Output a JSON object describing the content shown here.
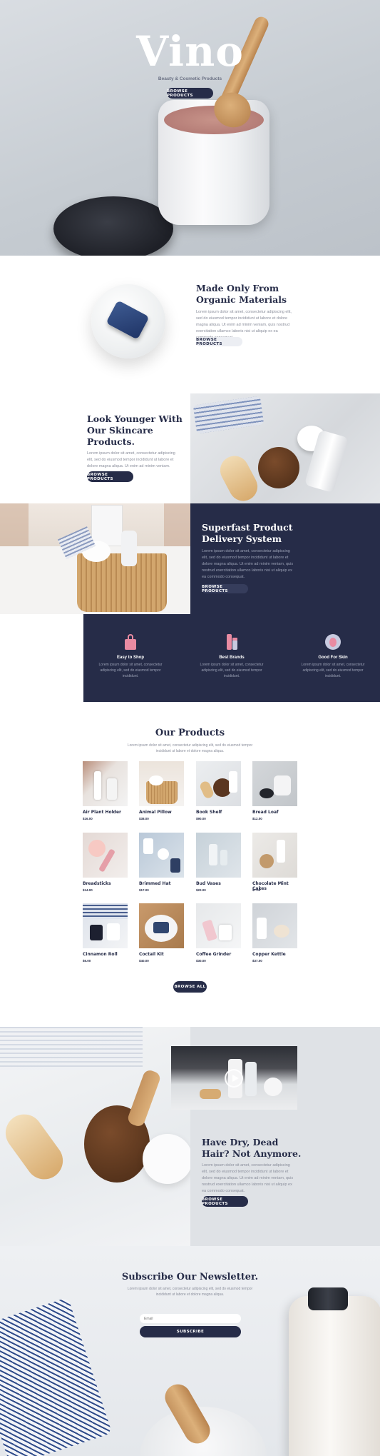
{
  "hero": {
    "brand": "Vino",
    "tagline": "Beauty & Cosmetic Products",
    "button": "Browse Products"
  },
  "organic": {
    "title_line1": "Made Only From",
    "title_line2": "Organic Materials",
    "body": "Lorem ipsum dolor sit amet, consectetur adipiscing elit, sed do eiusmod tempor incididunt ut labore et dolore magna aliqua. Ut enim ad minim veniam, quis nostrud exercitation ullamco laboris nisi ut aliquip ex ea commodo consequat.",
    "button": "Browse Products"
  },
  "younger": {
    "title_line1": "Look Younger With",
    "title_line2": "Our Skincare",
    "title_line3": "Products.",
    "body": "Lorem ipsum dolor sit amet, consectetur adipiscing elit, sed do eiusmod tempor incididunt ut labore et dolore magna aliqua. Ut enim ad minim veniam.",
    "button": "Browse Products"
  },
  "delivery": {
    "title_line1": "Superfast Product",
    "title_line2": "Delivery System",
    "body": "Lorem ipsum dolor sit amet, consectetur adipiscing elit, sed do eiusmod tempor incididunt ut labore et dolore magna aliqua. Ut enim ad minim veniam, quis nostrud exercitation ullamco laboris nisi ut aliquip ex ea commodo consequat.",
    "button": "Browse Products"
  },
  "features": [
    {
      "icon": "shopping-bag-icon",
      "title": "Easy to Shop",
      "body": "Lorem ipsum dolor sit amet, consectetur adipiscing elit, sed do eiusmod tempor incididunt."
    },
    {
      "icon": "cosmetics-icon",
      "title": "Best Brands",
      "body": "Lorem ipsum dolor sit amet, consectetur adipiscing elit, sed do eiusmod tempor incididunt."
    },
    {
      "icon": "face-icon",
      "title": "Good For Skin",
      "body": "Lorem ipsum dolor sit amet, consectetur adipiscing elit, sed do eiusmod tempor incididunt."
    }
  ],
  "products": {
    "title": "Our Products",
    "subtitle": "Lorem ipsum dolor sit amet, consectetur adipiscing elit, sed do eiusmod tempor incididunt ut labore et dolore magna aliqua.",
    "items": [
      {
        "name": "Air Plant Holder",
        "price": "$16.00"
      },
      {
        "name": "Animal Pillow",
        "price": "$38.00"
      },
      {
        "name": "Book Shelf",
        "price": "$90.00"
      },
      {
        "name": "Bread Loaf",
        "price": "$12.00"
      },
      {
        "name": "Breadsticks",
        "price": "$14.00"
      },
      {
        "name": "Brimmed Hat",
        "price": "$17.00"
      },
      {
        "name": "Bud Vases",
        "price": "$22.00"
      },
      {
        "name": "Chocolate Mint Cakes",
        "price": "$7.00"
      },
      {
        "name": "Cinnamon Roll",
        "price": "$6.00"
      },
      {
        "name": "Coctail Kit",
        "price": "$40.00"
      },
      {
        "name": "Coffee Grinder",
        "price": "$30.00"
      },
      {
        "name": "Copper Kettle",
        "price": "$37.00"
      }
    ],
    "button": "Browse All"
  },
  "hair": {
    "title_line1": "Have Dry, Dead",
    "title_line2": "Hair? Not Anymore.",
    "body": "Lorem ipsum dolor sit amet, consectetur adipiscing elit, sed do eiusmod tempor incididunt ut labore et dolore magna aliqua. Ut enim ad minim veniam, quis nostrud exercitation ullamco laboris nisi ut aliquip ex ea commodo consequat.",
    "button": "Browse Products"
  },
  "newsletter": {
    "title": "Subscribe Our Newsletter.",
    "body": "Lorem ipsum dolor sit amet, consectetur adipiscing elit, sed do eiusmod tempor incididunt ut labore et dolore magna aliqua.",
    "email_placeholder": "Email",
    "button": "Subscribe"
  },
  "colors": {
    "navy": "#262c48",
    "hero_bg": "#c9ced4",
    "accent_pink": "#e98ba2"
  }
}
